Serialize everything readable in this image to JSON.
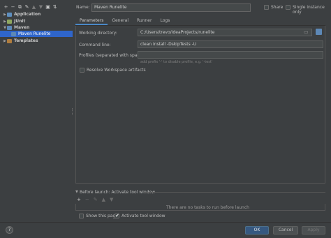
{
  "toolbar": {
    "icons": [
      "add-icon",
      "remove-icon",
      "copy-icon",
      "wrench-icon",
      "move-up-icon",
      "move-down-icon",
      "folder-icon",
      "sort-icon"
    ]
  },
  "tree": {
    "items": [
      {
        "label": "Application",
        "indent": 0,
        "expandable": true,
        "expanded": false,
        "bold": true,
        "icon_color": "#5e8fbf"
      },
      {
        "label": "JUnit",
        "indent": 0,
        "expandable": true,
        "expanded": false,
        "bold": true,
        "icon_color": "#8fa860"
      },
      {
        "label": "Maven",
        "indent": 0,
        "expandable": true,
        "expanded": true,
        "bold": true,
        "icon_color": "#5d88b6"
      },
      {
        "label": "Maven Runelite",
        "indent": 1,
        "expandable": false,
        "selected": true,
        "bold": false,
        "icon_color": "#5d88b6"
      },
      {
        "label": "Templates",
        "indent": 0,
        "expandable": true,
        "expanded": false,
        "bold": true,
        "icon_color": "#b07d3e"
      }
    ]
  },
  "form": {
    "name_label": "Name:",
    "name_value": "Maven Runelite",
    "share_label": "Share",
    "single_instance_label": "Single instance only"
  },
  "tabs": [
    "Parameters",
    "General",
    "Runner",
    "Logs"
  ],
  "parameters": {
    "working_dir_label": "Working directory:",
    "working_dir_value": "C:/Users/trevo/IdeaProjects/runelite",
    "command_line_label": "Command line:",
    "command_line_value": "clean install -DskipTests -U",
    "profiles_label": "Profiles (separated with space):",
    "profiles_value": "",
    "profiles_hint": "add prefix '-' to disable profile, e.g. '-test'",
    "resolve_label": "Resolve Workspace artifacts"
  },
  "before_launch": {
    "label": "Before launch: Activate tool window",
    "empty_text": "There are no tasks to run before launch"
  },
  "footer": {
    "show_page_label": "Show this page",
    "activate_label": "Activate tool window",
    "activate_checked": true,
    "help_label": "?",
    "ok_label": "OK",
    "cancel_label": "Cancel",
    "apply_label": "Apply"
  },
  "colors": {
    "background": "#3c3f41",
    "selection": "#2f65ca",
    "primary_button": "#365880",
    "accent_tab": "#4a88c7"
  }
}
